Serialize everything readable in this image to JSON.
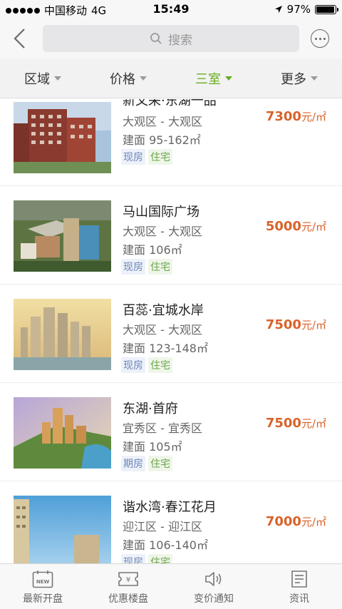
{
  "status_bar": {
    "carrier": "中国移动",
    "network": "4G",
    "time": "15:49",
    "battery": "97%",
    "battery_level": 0.97
  },
  "header": {
    "search_placeholder": "搜索"
  },
  "filters": [
    {
      "label": "区域",
      "active": false
    },
    {
      "label": "价格",
      "active": false
    },
    {
      "label": "三室",
      "active": true
    },
    {
      "label": "更多",
      "active": false
    }
  ],
  "listings": [
    {
      "name": "新文采·东湖一品",
      "district": "大观区 - 大观区",
      "area": "建面 95-162㎡",
      "status": "现房",
      "type": "住宅",
      "price": "7300",
      "unit": "元/㎡"
    },
    {
      "name": "马山国际广场",
      "district": "大观区 - 大观区",
      "area": "建面 106㎡",
      "status": "现房",
      "type": "住宅",
      "price": "5000",
      "unit": "元/㎡"
    },
    {
      "name": "百蕊·宜城水岸",
      "district": "大观区 - 大观区",
      "area": "建面 123-148㎡",
      "status": "现房",
      "type": "住宅",
      "price": "7500",
      "unit": "元/㎡"
    },
    {
      "name": "东湖·首府",
      "district": "宜秀区 - 宜秀区",
      "area": "建面 105㎡",
      "status": "期房",
      "type": "住宅",
      "price": "7500",
      "unit": "元/㎡"
    },
    {
      "name": "谐水湾·春江花月",
      "district": "迎江区 - 迎江区",
      "area": "建面 106-140㎡",
      "status": "现房",
      "type": "住宅",
      "price": "7000",
      "unit": "元/㎡"
    }
  ],
  "tabbar": [
    {
      "label": "最新开盘",
      "icon": "new-icon",
      "badge": "NEW"
    },
    {
      "label": "优惠楼盘",
      "icon": "ticket-icon",
      "badge": "¥"
    },
    {
      "label": "变价通知",
      "icon": "speaker-icon"
    },
    {
      "label": "资讯",
      "icon": "news-icon"
    }
  ],
  "colors": {
    "accent": "#6aad1e",
    "price": "#d9632a"
  }
}
